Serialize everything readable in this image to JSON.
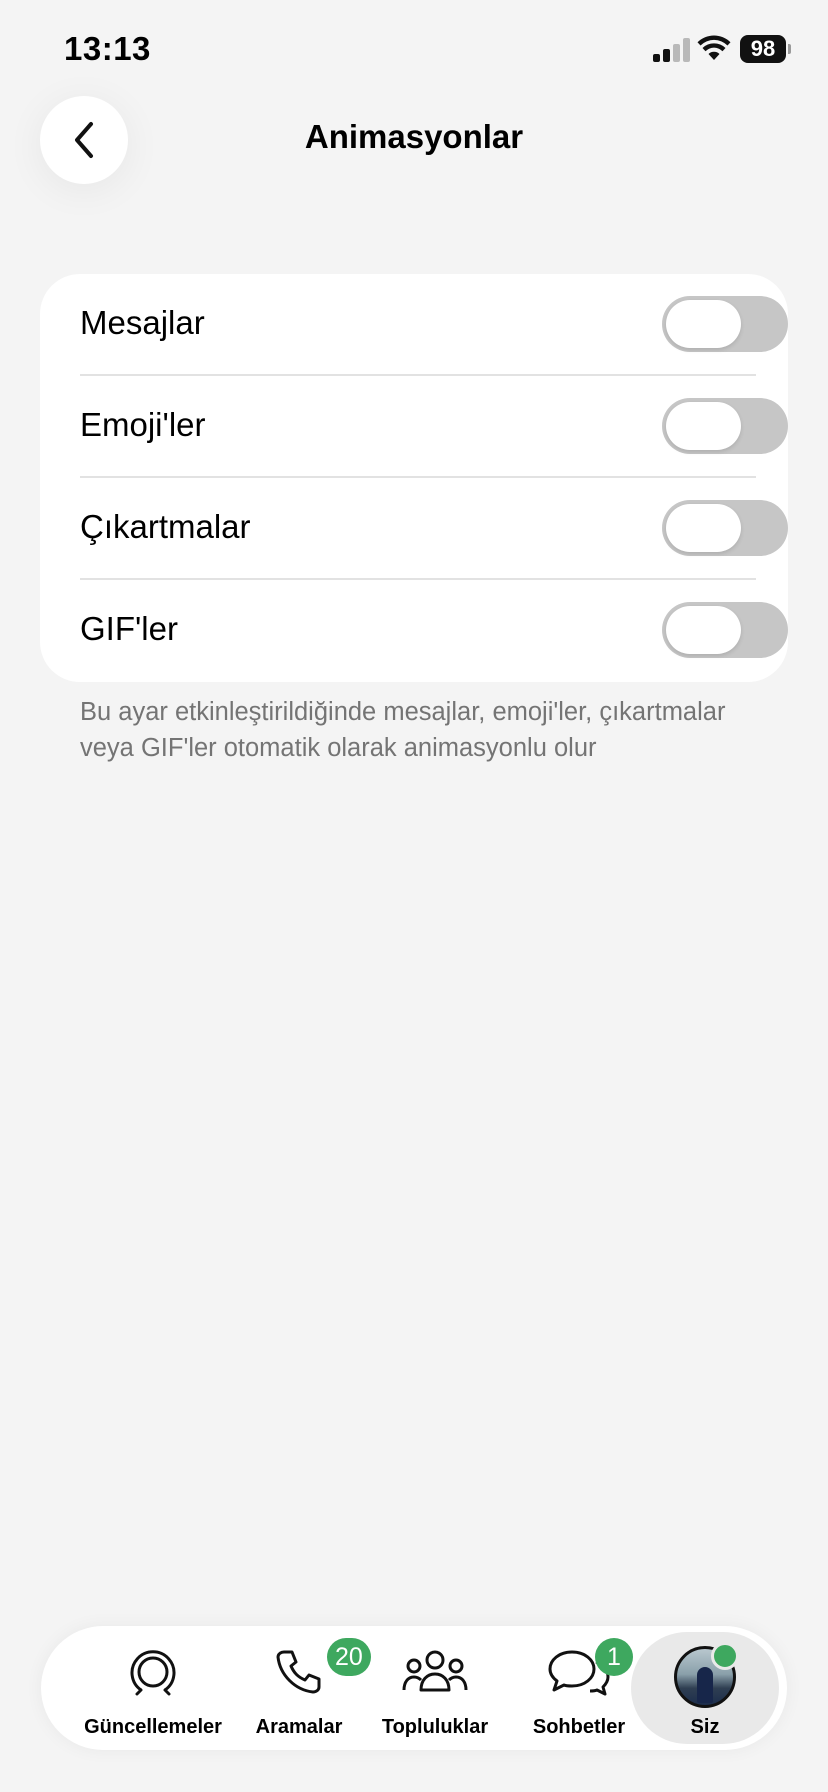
{
  "status_bar": {
    "time": "13:13",
    "battery": "98"
  },
  "header": {
    "title": "Animasyonlar",
    "back_icon": "chevron-left-icon"
  },
  "settings": [
    {
      "label": "Mesajlar",
      "enabled": false
    },
    {
      "label": "Emoji'ler",
      "enabled": false
    },
    {
      "label": "Çıkartmalar",
      "enabled": false
    },
    {
      "label": "GIF'ler",
      "enabled": false
    }
  ],
  "footnote": "Bu ayar etkinleştirildiğinde mesajlar, emoji'ler, çıkartmalar veya GIF'ler otomatik olarak animasyonlu olur",
  "bottom_nav": {
    "items": [
      {
        "label": "Güncellemeler",
        "icon": "updates-icon"
      },
      {
        "label": "Aramalar",
        "icon": "phone-icon",
        "badge": "20"
      },
      {
        "label": "Topluluklar",
        "icon": "communities-icon"
      },
      {
        "label": "Sohbetler",
        "icon": "chats-icon",
        "badge": "1"
      },
      {
        "label": "Siz",
        "icon": "avatar",
        "active": true
      }
    ]
  },
  "colors": {
    "accent": "#3ea85f",
    "toggle_off": "#c6c6c6",
    "background": "#f4f4f4"
  }
}
